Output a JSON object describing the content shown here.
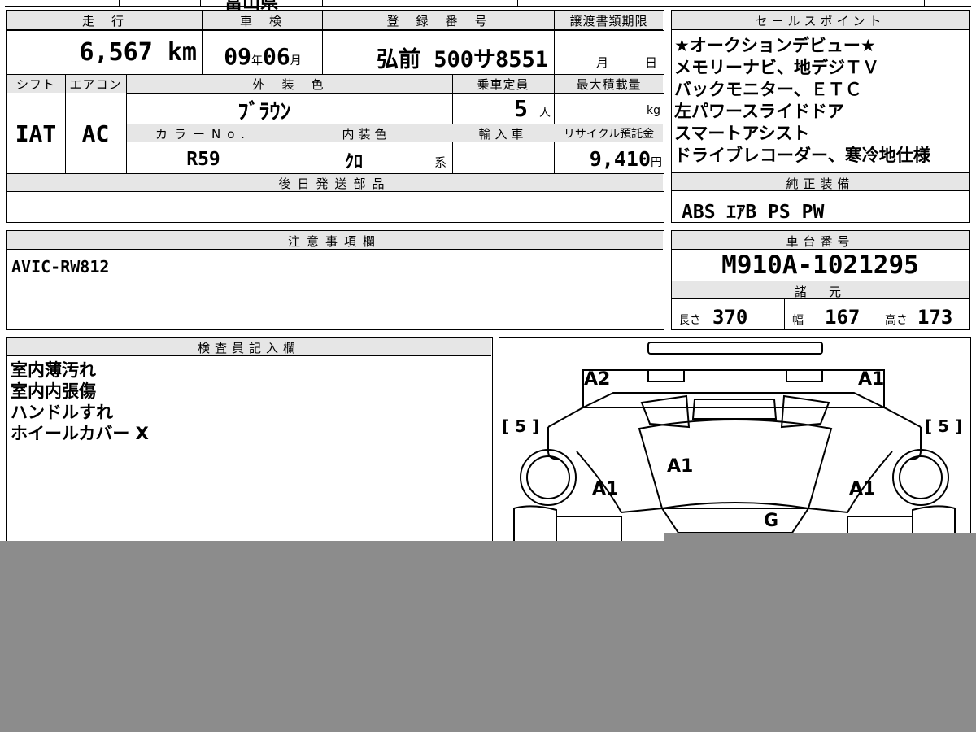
{
  "top_text": "富山県",
  "headers": {
    "mileage": "走　行",
    "inspection": "車　検",
    "registration": "登　録　番　号",
    "transfer_deadline": "譲渡書類期限",
    "sales_points": "セールスポイント",
    "shift": "シフト",
    "aircon": "エアコン",
    "exterior_color": "外　装　色",
    "capacity": "乗車定員",
    "max_load": "最大積載量",
    "color_no": "カラーNo.",
    "interior_color": "内装色",
    "import": "輸入車",
    "recycle_fee": "リサイクル預託金",
    "later_parts": "後日発送部品",
    "genuine_equipment": "純正装備",
    "remarks": "注意事項欄",
    "chassis_no": "車台番号",
    "dimensions": "諸　元",
    "inspector": "検査員記入欄"
  },
  "values": {
    "mileage": "6,567",
    "mileage_unit": "km",
    "inspection_year": "09",
    "year_unit": "年",
    "inspection_month": "06",
    "month_unit": "月",
    "registration_number": "弘前 500サ8551",
    "deadline_month_unit": "月",
    "deadline_day_unit": "日",
    "shift": "IAT",
    "aircon": "AC",
    "exterior_color": "ﾌﾞﾗｳﾝ",
    "capacity": "5",
    "capacity_unit": "人",
    "max_load_unit": "kg",
    "color_no": "R59",
    "interior_color": "ｸﾛ",
    "interior_suffix": "系",
    "recycle_fee": "9,410",
    "recycle_unit": "円",
    "genuine_equipment": "ABS ｴｱB PS PW",
    "remarks": "AVIC-RW812",
    "chassis_number": "M910A-1021295",
    "length_label": "長さ",
    "length": "370",
    "width_label": "幅",
    "width": "167",
    "height_label": "高さ",
    "height": "173"
  },
  "sales_points": [
    "★オークションデビュー★",
    "メモリーナビ、地デジＴＶ",
    "バックモニター、ＥＴＣ",
    "左パワースライドドア",
    "スマートアシスト",
    "ドライブレコーダー、寒冷地仕様"
  ],
  "inspector_notes": [
    "室内薄汚れ",
    "室内内張傷",
    "ハンドルすれ",
    "ホイールカバー X"
  ],
  "diagram": {
    "front_left": "A2",
    "front_right": "A1",
    "left_bracket": "[ 5 ]",
    "right_bracket": "[ 5 ]",
    "hood": "A1",
    "left_fender": "A1",
    "right_fender": "A1",
    "windshield": "G"
  },
  "colors": {
    "header_bg": "#e6e6e6",
    "overlay_gray": "#8c8c8c"
  }
}
